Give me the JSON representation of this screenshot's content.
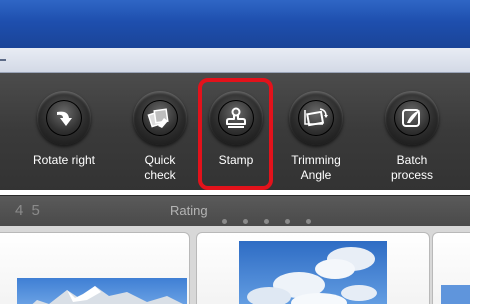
{
  "toolbar": {
    "tools": [
      {
        "label": "Rotate right",
        "icon": "rotate-right-icon"
      },
      {
        "label": "Quick\ncheck",
        "icon": "quick-check-icon"
      },
      {
        "label": "Stamp",
        "icon": "stamp-icon",
        "highlighted": true
      },
      {
        "label": "Trimming\nAngle",
        "icon": "trimming-angle-icon"
      },
      {
        "label": "Batch\nprocess",
        "icon": "batch-process-icon"
      }
    ],
    "highlight_color": "#e3121b"
  },
  "rating_bar": {
    "numbers": "4 5",
    "label": "Rating",
    "star_count": 5
  },
  "colors": {
    "titlebar": "#1e4fae",
    "toolbar": "#3a3a3a",
    "label_text": "#ffffff"
  }
}
